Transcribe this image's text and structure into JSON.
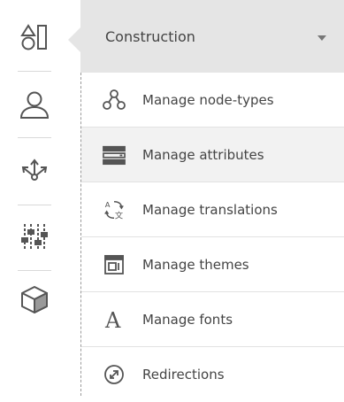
{
  "sidebar": {
    "items": [
      {
        "name": "construction",
        "icon": "shapes-icon",
        "active": true
      },
      {
        "name": "users",
        "icon": "user-icon"
      },
      {
        "name": "workflow",
        "icon": "workflow-arrows-icon"
      },
      {
        "name": "settings",
        "icon": "sliders-icon"
      },
      {
        "name": "packages",
        "icon": "cube-icon"
      }
    ]
  },
  "section_select": {
    "value": "Construction"
  },
  "menu": {
    "items": [
      {
        "label": "Manage node-types",
        "icon": "node-types-icon"
      },
      {
        "label": "Manage attributes",
        "icon": "attributes-icon",
        "active": true
      },
      {
        "label": "Manage translations",
        "icon": "translations-icon"
      },
      {
        "label": "Manage themes",
        "icon": "themes-icon"
      },
      {
        "label": "Manage fonts",
        "icon": "fonts-icon"
      },
      {
        "label": "Redirections",
        "icon": "redirections-icon"
      }
    ]
  },
  "colors": {
    "icon": "#555555",
    "dropdown_bg": "#e5e5e5",
    "active_row_bg": "#f2f2f2"
  }
}
